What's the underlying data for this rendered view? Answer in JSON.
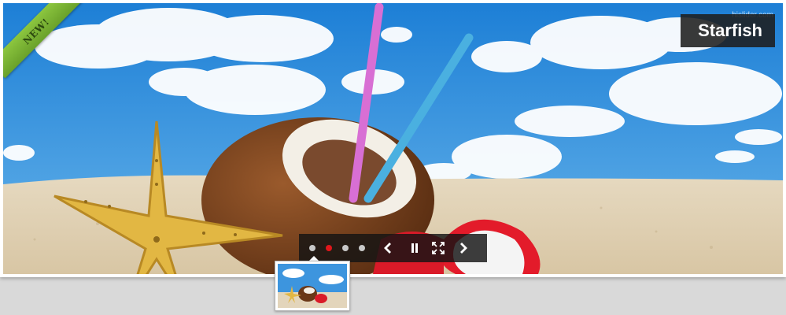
{
  "slider": {
    "caption": "Starfish",
    "ribbon_label": "NEW!",
    "watermark": "hislider.com",
    "slide_count": 4,
    "active_slide_index": 1,
    "controls": {
      "prev_icon": "chevron-left-icon",
      "pause_icon": "pause-icon",
      "fullscreen_icon": "fullscreen-icon",
      "next_icon": "chevron-right-icon"
    },
    "colors": {
      "active_dot": "#e0161b",
      "inactive_dot": "#c8c8c8",
      "ribbon": "#7ab535",
      "caption_bg": "#1e1e1e"
    }
  }
}
